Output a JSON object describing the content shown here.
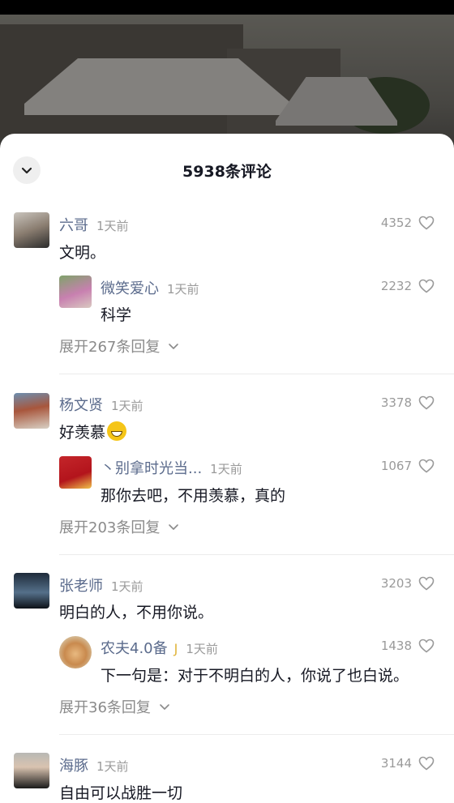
{
  "header": {
    "title": "5938条评论"
  },
  "comments": [
    {
      "user": "六哥",
      "time": "1天前",
      "text": "文明。",
      "likes": "4352",
      "reply": {
        "user": "微笑爱心",
        "time": "1天前",
        "text": "科学",
        "likes": "2232"
      },
      "expand": "展开267条回复"
    },
    {
      "user": "杨文贤",
      "time": "1天前",
      "text": "好羡慕",
      "likes": "3378",
      "reply": {
        "user": "丶别拿时光当...",
        "time": "1天前",
        "text": "那你去吧，不用羡慕，真的",
        "likes": "1067"
      },
      "expand": "展开203条回复"
    },
    {
      "user": "张老师",
      "time": "1天前",
      "text": "明白的人，不用你说。",
      "likes": "3203",
      "reply": {
        "user": "农夫4.0备",
        "time": "1天前",
        "text": "下一句是：对于不明白的人，你说了也白说。",
        "likes": "1438"
      },
      "expand": "展开36条回复"
    },
    {
      "user": "海豚",
      "time": "1天前",
      "text": "自由可以战胜一切",
      "likes": "3144"
    }
  ]
}
